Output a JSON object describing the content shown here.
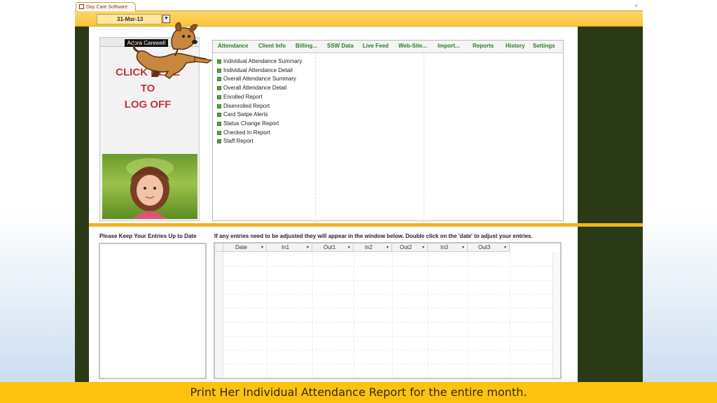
{
  "window": {
    "tab_title": "Day Care Software",
    "close_glyph": "×"
  },
  "header": {
    "date_value": "31-Mar-13",
    "dropdown_glyph": "▼"
  },
  "user_panel": {
    "user_name": "Adora Carewell",
    "logoff_lines": [
      "CLICK HERE",
      "TO",
      "LOG OFF"
    ],
    "photo_icon": "child-photo"
  },
  "nav": {
    "tabs": [
      "Attendance",
      "Client Info",
      "Billing...",
      "SSW Data",
      "Live Feed",
      "Web-Site...",
      "Import...",
      "Reports",
      "History",
      "Settings"
    ],
    "reports": [
      "Individual Attendance Summary",
      "Individual Attendance Detail",
      "Overall Attendance Summary",
      "Overall Attendance Detail",
      "Enrolled Report",
      "Disenrolled Report",
      "Card Swipe Alerts",
      "Status Change Report",
      "Checked In Report",
      "Staff Report"
    ]
  },
  "lower": {
    "keep_label": "Please Keep Your Entries Up to Date",
    "adjust_label": "If any entries need to be adjusted they will appear in the window below. Double click on the 'date' to adjust your entries.",
    "columns": [
      "Date",
      "In1",
      "Out1",
      "In2",
      "Out2",
      "In3",
      "Out3"
    ],
    "sort_glyph": "▾"
  },
  "caption": "Print Her Individual Attendance Report for the entire month.",
  "colors": {
    "accent_gold": "#efb51f",
    "dark_panel": "#2b3a16",
    "tab_green": "#2d7a2d",
    "logoff_red": "#c8323c"
  }
}
